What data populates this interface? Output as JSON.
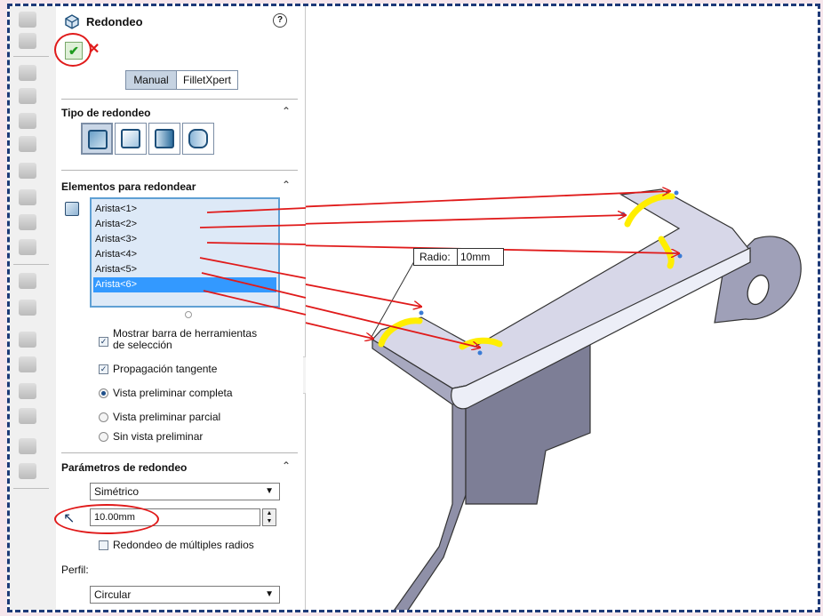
{
  "panel": {
    "title": "Redondeo",
    "help_label": "?",
    "ok_label": "✔",
    "cancel_label": "✕",
    "modes": [
      "Manual",
      "FilletXpert"
    ],
    "sections": {
      "tipo": "Tipo de redondeo",
      "elementos": "Elementos para redondear",
      "parametros": "Parámetros de redondeo",
      "perfil": "Perfil:"
    },
    "edges": [
      "Arista<1>",
      "Arista<2>",
      "Arista<3>",
      "Arista<4>",
      "Arista<5>",
      "Arista<6>"
    ],
    "selected_edge_index": 5,
    "options": {
      "mostrar_line1": "Mostrar barra de herramientas",
      "mostrar_line2": "de selección",
      "mostrar_checked": true,
      "propagacion": "Propagación tangente",
      "propagacion_checked": true,
      "preview_full": "Vista preliminar completa",
      "preview_partial": "Vista preliminar parcial",
      "preview_none": "Sin vista preliminar",
      "preview_selected": "full"
    },
    "parameters": {
      "method": "Simétrico",
      "radius_value": "10.00mm",
      "multi_radius": "Redondeo de múltiples radios",
      "multi_radius_checked": false,
      "profile": "Circular"
    }
  },
  "viewport": {
    "callout_label": "Radio:",
    "callout_value": "10mm"
  },
  "colors": {
    "accent_red": "#e01a1a",
    "highlight_yellow": "#ffee00",
    "selection_blue": "#3399ff",
    "frame_dashed": "#1e3a78"
  },
  "icons": [
    "fillet-feature-icon",
    "help-icon",
    "confirm-icon",
    "cancel-icon",
    "fillet-type-constant-icon",
    "fillet-type-variable-icon",
    "fillet-type-face-icon",
    "fillet-type-full-round-icon",
    "edge-selection-icon",
    "radius-icon"
  ]
}
